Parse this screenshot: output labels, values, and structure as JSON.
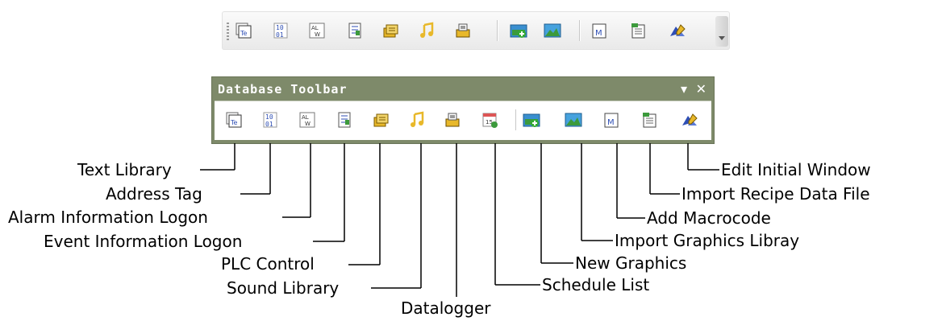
{
  "floating_toolbar": {
    "title": "Database Toolbar",
    "menu_glyph": "▾",
    "close_glyph": "✕"
  },
  "tools": [
    {
      "key": "text-library",
      "icon": "text-library-icon",
      "label": "Text Library"
    },
    {
      "key": "address-tag",
      "icon": "address-tag-icon",
      "label": "Address Tag"
    },
    {
      "key": "alarm-info",
      "icon": "alarm-information-icon",
      "label": "Alarm Information Logon"
    },
    {
      "key": "event-info",
      "icon": "event-information-icon",
      "label": "Event Information Logon"
    },
    {
      "key": "plc-control",
      "icon": "plc-control-icon",
      "label": "PLC Control"
    },
    {
      "key": "sound-library",
      "icon": "sound-library-icon",
      "label": "Sound Library"
    },
    {
      "key": "datalogger",
      "icon": "datalogger-icon",
      "label": "Datalogger"
    },
    {
      "key": "schedule-list",
      "icon": "schedule-list-icon",
      "label": "Schedule List"
    },
    {
      "key": "new-graphics",
      "icon": "new-graphics-icon",
      "label": "New Graphics"
    },
    {
      "key": "import-graphics",
      "icon": "import-graphics-icon",
      "label": "Import Graphics Libray"
    },
    {
      "key": "add-macrocode",
      "icon": "add-macrocode-icon",
      "label": "Add Macrocode"
    },
    {
      "key": "import-recipe",
      "icon": "import-recipe-icon",
      "label": "Import Recipe Data File"
    },
    {
      "key": "edit-initial-window",
      "icon": "edit-initial-window-icon",
      "label": "Edit Initial Window"
    }
  ],
  "glyphs": {
    "text-library": "Te",
    "address-tag": [
      "10",
      "01"
    ],
    "alarm-info": [
      "AL",
      "W"
    ],
    "add-macrocode": "M",
    "schedule-list": "15"
  },
  "colors": {
    "title_bar": "#7e8a6a",
    "icon_blue": "#2f4fb5",
    "icon_green": "#3c9a3c",
    "icon_yellow": "#e8b82a",
    "leader_line": "#000000"
  }
}
